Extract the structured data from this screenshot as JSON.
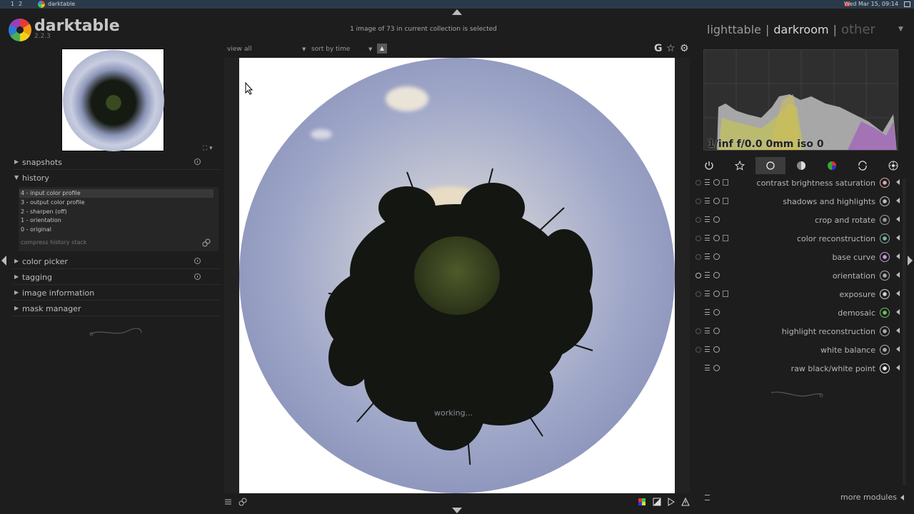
{
  "system_bar": {
    "workspaces": [
      "1",
      "2"
    ],
    "app_title": "darktable",
    "clock": "Wed Mar 15, 09:14"
  },
  "header": {
    "app_name": "darktable",
    "version": "2.2.3",
    "collection_info": "1 image of 73 in current collection is selected",
    "views": {
      "lighttable": "lighttable",
      "darkroom": "darkroom",
      "other": "other",
      "separator": "|"
    }
  },
  "left_panel": {
    "items": {
      "snapshots": "snapshots",
      "history": "history",
      "color_picker": "color picker",
      "tagging": "tagging",
      "image_information": "image information",
      "mask_manager": "mask manager"
    },
    "history": {
      "entries": [
        "4 - input color profile",
        "3 - output color profile",
        "2 - sharpen (off)",
        "1 - orientation",
        "0 - original"
      ],
      "compress": "compress history stack"
    }
  },
  "center": {
    "view_label": "view",
    "view_value": "all",
    "sort_label": "sort by",
    "sort_value": "time",
    "sort_direction_icon": "▲",
    "top_icons": {
      "grouping": "G",
      "star": "☆",
      "gear": "⚙"
    },
    "working_text": "working..."
  },
  "right_panel": {
    "histogram_info": "1/inf f/0.0 0mm iso 0",
    "modules": [
      {
        "name": "contrast brightness saturation",
        "icon_color": "#d9a8a8"
      },
      {
        "name": "shadows and highlights",
        "icon_color": "#bdbdbd"
      },
      {
        "name": "crop and rotate",
        "icon_color": "#9a9a9a"
      },
      {
        "name": "color reconstruction",
        "icon_color": "#7fb4a8"
      },
      {
        "name": "base curve",
        "icon_color": "#c39bd3"
      },
      {
        "name": "orientation",
        "icon_color": "#aaaaaa"
      },
      {
        "name": "exposure",
        "icon_color": "#d0d0d0"
      },
      {
        "name": "demosaic",
        "icon_color": "#6fbf5f"
      },
      {
        "name": "highlight reconstruction",
        "icon_color": "#aaaaaa"
      },
      {
        "name": "white balance",
        "icon_color": "#aaaaaa"
      },
      {
        "name": "raw black/white point",
        "icon_color": "#eeeeee"
      }
    ],
    "more_modules": "more modules"
  }
}
